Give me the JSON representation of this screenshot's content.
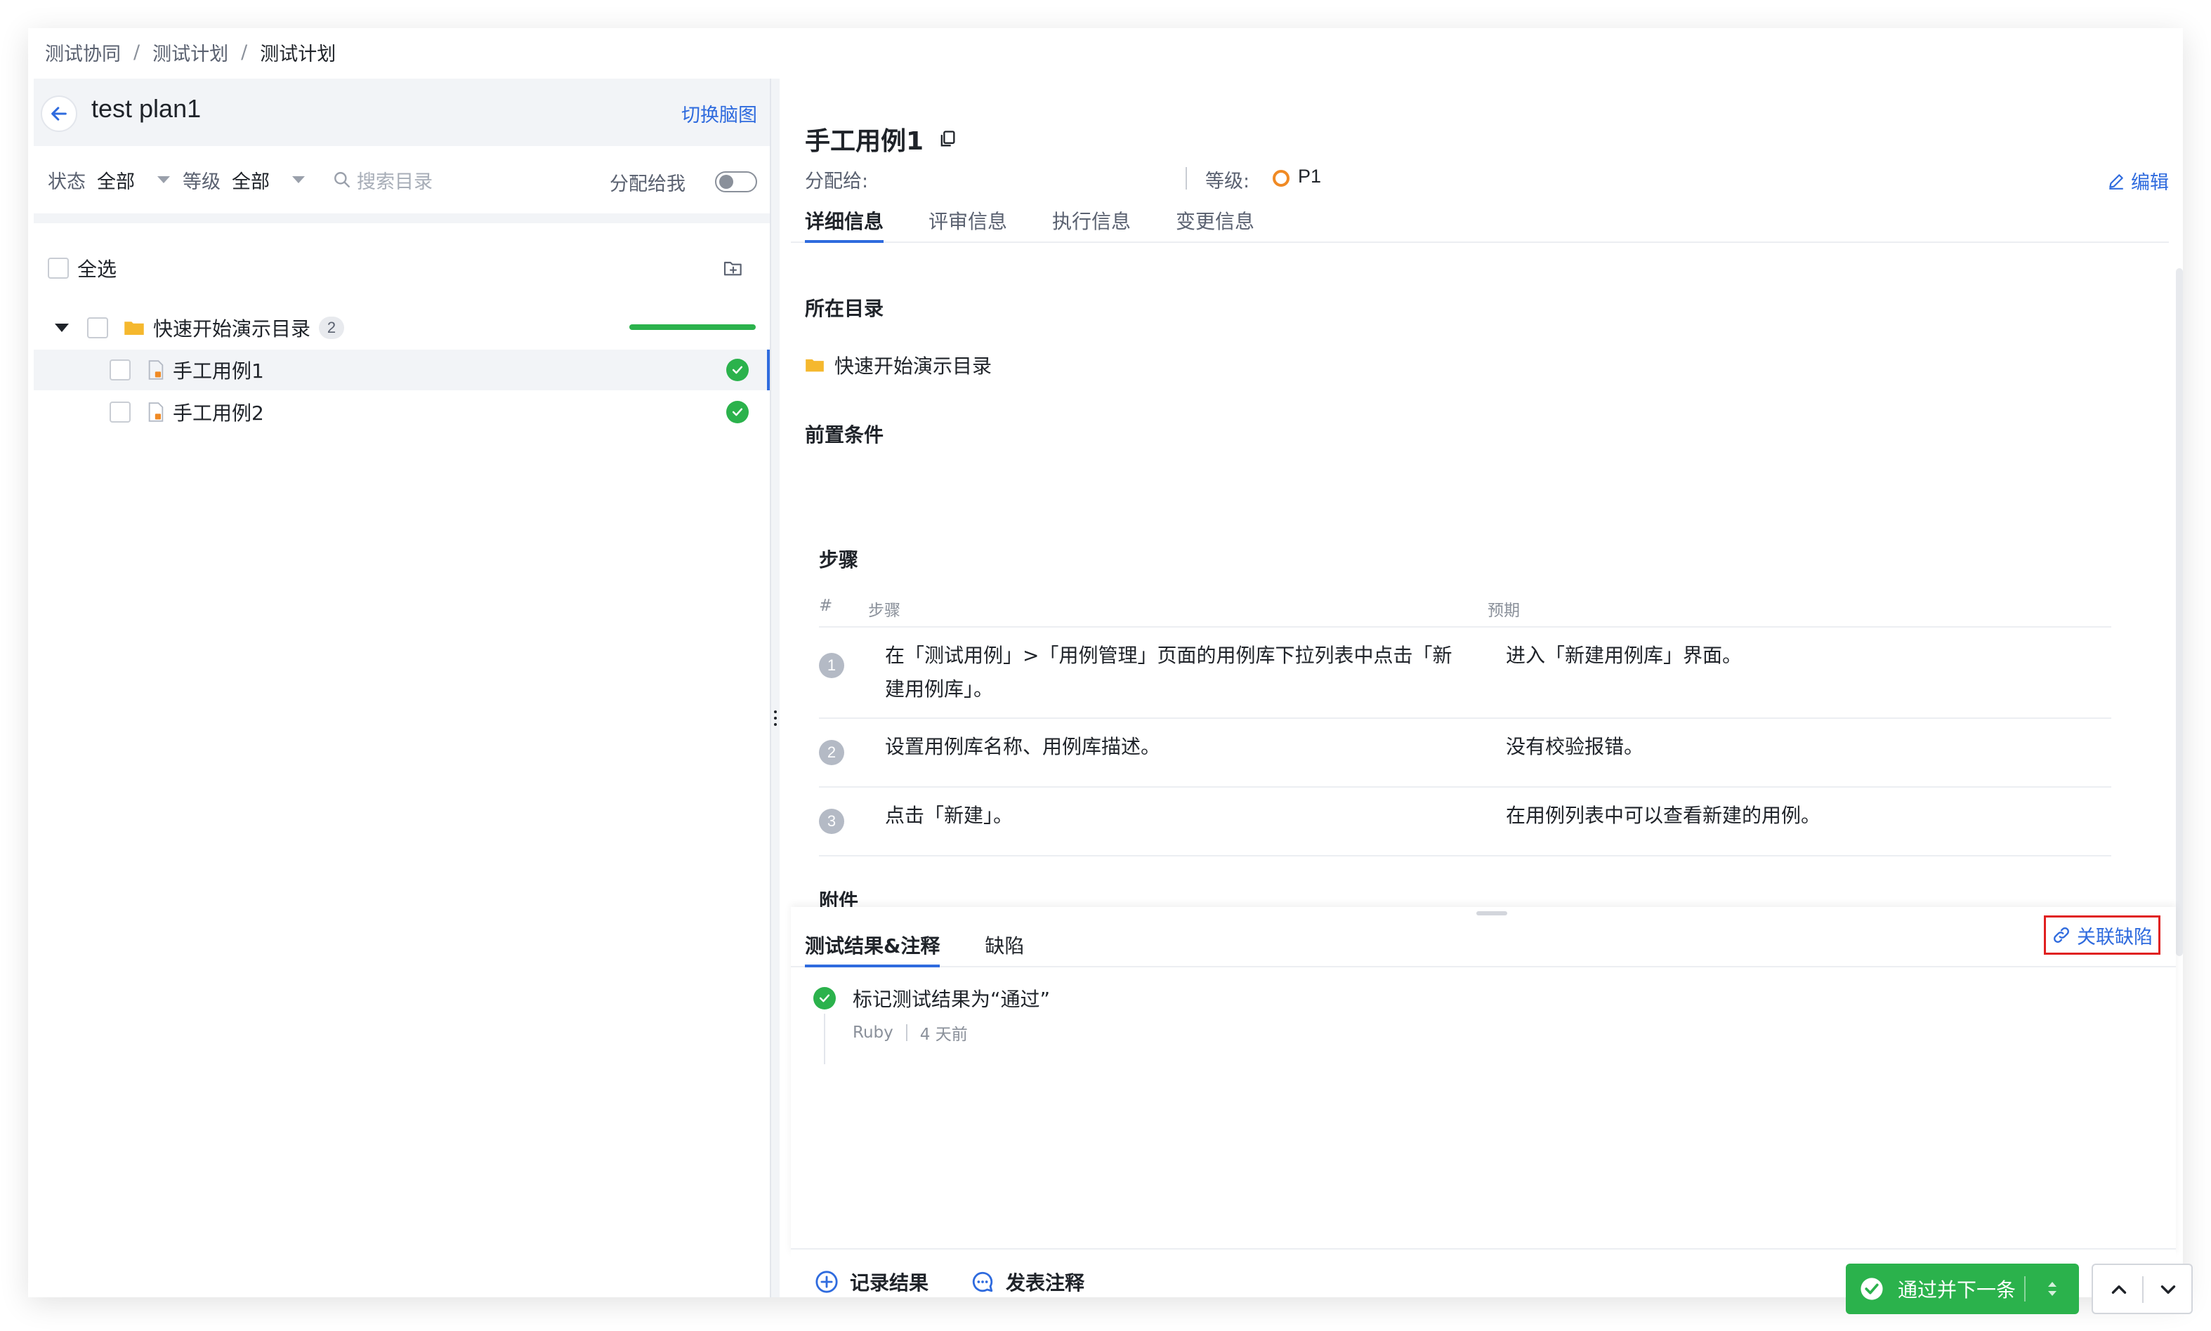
{
  "breadcrumb": [
    "测试协同",
    "测试计划",
    "测试计划"
  ],
  "breadcrumb_sep": "/",
  "left": {
    "title": "test plan1",
    "switch_view": "切换脑图",
    "filter": {
      "status_label": "状态",
      "status_value": "全部",
      "level_label": "等级",
      "level_value": "全部",
      "search_placeholder": "搜索目录",
      "assign_me": "分配给我",
      "assign_me_on": false
    },
    "select_all": "全选",
    "tree": {
      "folder": {
        "name": "快速开始演示目录",
        "count": "2",
        "progress": 1.0
      },
      "cases": [
        {
          "name": "手工用例1",
          "status": "passed",
          "selected": true
        },
        {
          "name": "手工用例2",
          "status": "passed",
          "selected": false
        }
      ]
    }
  },
  "detail": {
    "title": "手工用例1",
    "assign_label": "分配给:",
    "assign_value": "",
    "level_label": "等级:",
    "level_value": "P1",
    "level_color": "#f08a24",
    "edit": "编辑",
    "tabs": [
      "详细信息",
      "评审信息",
      "执行信息",
      "变更信息"
    ],
    "active_tab": 0,
    "directory_title": "所在目录",
    "directory_value": "快速开始演示目录",
    "precondition_title": "前置条件",
    "steps_title": "步骤",
    "steps_columns": {
      "num": "#",
      "step": "步骤",
      "expected": "预期"
    },
    "steps": [
      {
        "num": "1",
        "step": "在「测试用例」>「用例管理」页面的用例库下拉列表中点击「新建用例库」。",
        "expected": "进入「新建用例库」界面。"
      },
      {
        "num": "2",
        "step": "设置用例库名称、用例库描述。",
        "expected": "没有校验报错。"
      },
      {
        "num": "3",
        "step": "点击「新建」。",
        "expected": "在用例列表中可以查看新建的用例。"
      }
    ],
    "attachment_title": "附件"
  },
  "result_pane": {
    "tabs": [
      "测试结果&注释",
      "缺陷"
    ],
    "active_tab": 0,
    "link_defect": "关联缺陷",
    "log": [
      {
        "text": "标记测试结果为“通过”",
        "user": "Ruby",
        "time": "4 天前"
      }
    ]
  },
  "footer": {
    "record_result": "记录结果",
    "post_comment": "发表注释",
    "pass_next": "通过并下一条"
  },
  "colors": {
    "accent": "#2f6bde",
    "success": "#2bb24c",
    "highlight_border": "#e02020"
  }
}
